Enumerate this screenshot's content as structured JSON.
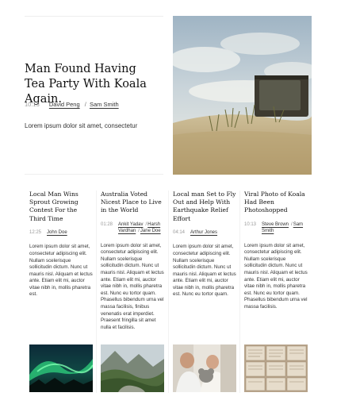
{
  "featured": {
    "title": "Man Found Having Tea Party With Koala Again.",
    "time": "10:13",
    "author1": "David Peng",
    "author2": "Sam Smith",
    "excerpt": "Lorem ipsum dolor sit amet, consectetur"
  },
  "cards": [
    {
      "title": "Local Man Wins Sprout Growing Contest For the Third Time",
      "time": "12:25",
      "authors": [
        "John Doe"
      ],
      "body": "Lorem ipsum dolor sit amet, consectetur adipiscing elit. Nullam scelerisque sollicitudin dictum. Nunc ut mauris nisl. Aliquam et lectus ante. Etiam elit mi, auctor vitae nibh in, mollis pharetra est."
    },
    {
      "title": "Australia Voted Nicest Place to Live in the World",
      "time": "01:28",
      "authors": [
        "Ankit Yadav",
        "Harsh Vardhan",
        "Jane Doe"
      ],
      "body": "Lorem ipsum dolor sit amet, consectetur adipiscing elit. Nullam scelerisque sollicitudin dictum. Nunc ut mauris nisl. Aliquam et lectus ante. Etiam elit mi, auctor vitae nibh in, mollis pharetra est. Nunc eu tortor quam. Phasellus bibendum urna vel massa facilisis, finibus venenatis erat imperdiet. Praesent fringilla sit amet nulla et facilisis."
    },
    {
      "title": "Local man Set to Fly Out and Help With Earthquake Relief Effort",
      "time": "04:14",
      "authors": [
        "Arthur Jones"
      ],
      "body": "Lorem ipsum dolor sit amet, consectetur adipiscing elit. Nullam scelerisque sollicitudin dictum. Nunc ut mauris nisl. Aliquam et lectus ante. Etiam elit mi, auctor vitae nibh in, mollis pharetra est. Nunc eu tortor quam."
    },
    {
      "title": "Viral Photo of Koala Had Been Photoshopped",
      "time": "10:13",
      "authors": [
        "Steve Brown",
        "Sam Smith"
      ],
      "body": "Lorem ipsum dolor sit amet, consectetur adipiscing elit. Nullam scelerisque sollicitudin dictum. Nunc ut mauris nisl. Aliquam et lectus ante. Etiam elit mi, auctor vitae nibh in, mollis pharetra est. Nunc eu tortor quam. Phasellus bibendum urna vel massa facilisis."
    }
  ],
  "images": {
    "hero": "tv-on-beach-photo",
    "card1": "aurora-photo",
    "card2": "mountain-valley-photo",
    "card3": "people-holding-koala-photo",
    "card4": "open-book-pages-photo"
  }
}
